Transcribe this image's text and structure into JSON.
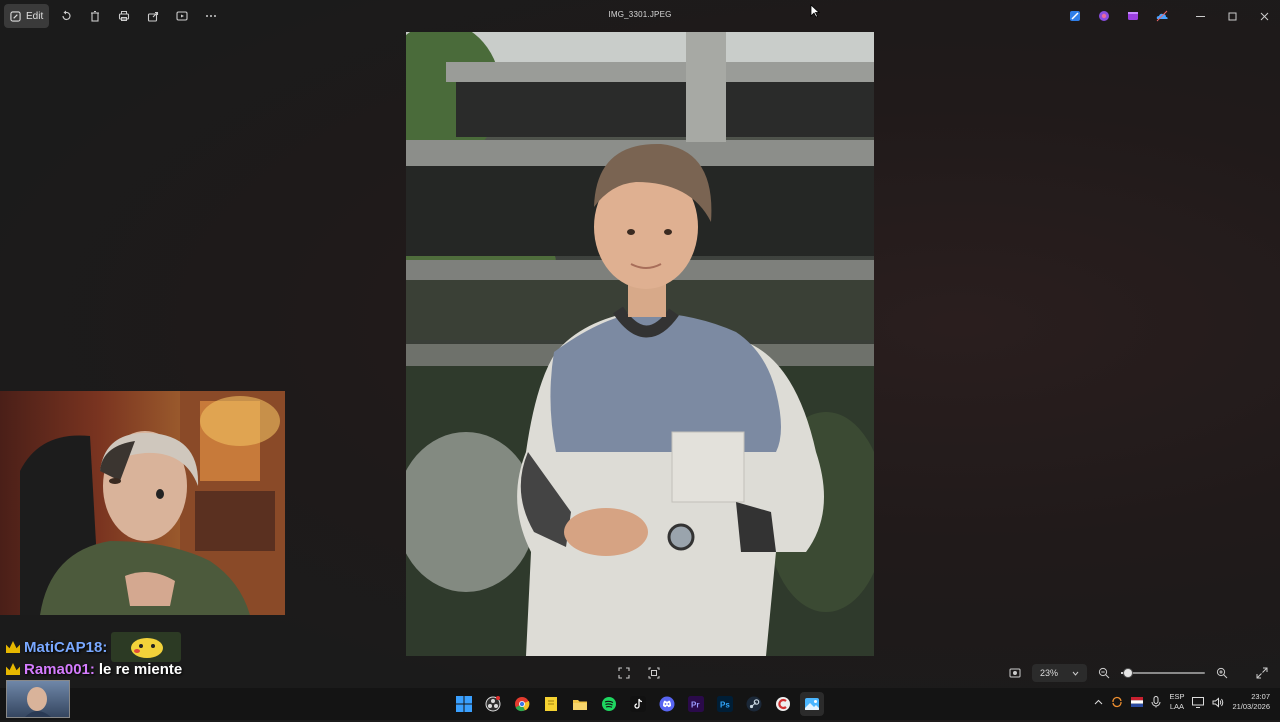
{
  "window": {
    "title": "IMG_3301.JPEG"
  },
  "toolbar": {
    "edit_label": "Edit",
    "icons": [
      "rotate-icon",
      "delete-icon",
      "print-icon",
      "share-icon",
      "slideshow-icon",
      "more-icon"
    ]
  },
  "header_apps": [
    "paint-icon",
    "clipchamp-icon",
    "video-editor-icon",
    "onedrive-icon"
  ],
  "window_controls": [
    "minimize",
    "maximize",
    "close"
  ],
  "webcam": {
    "description": "streamer camera overlay"
  },
  "chat": {
    "messages": [
      {
        "user": "MatiCAP18:",
        "text": ""
      },
      {
        "user": "Rama001:",
        "text": "le re miente"
      }
    ]
  },
  "viewer": {
    "zoom_label": "23%",
    "zoom_fraction": 0.02
  },
  "taskbar": {
    "apps": [
      "windows-start",
      "obs",
      "chrome",
      "file-notes",
      "file-explorer",
      "spotify",
      "ticktick",
      "discord",
      "premiere",
      "photoshop",
      "steam",
      "ccleaner",
      "photos"
    ],
    "active_app": "photos",
    "language_top": "ESP",
    "language_bottom": "LAA",
    "time": "23:07",
    "date": "21/03/2026"
  },
  "colors": {
    "accent": "#3b82f6",
    "chat_user1": "#79a8ff",
    "chat_user2": "#d57cff",
    "crown": "#e6b700"
  }
}
